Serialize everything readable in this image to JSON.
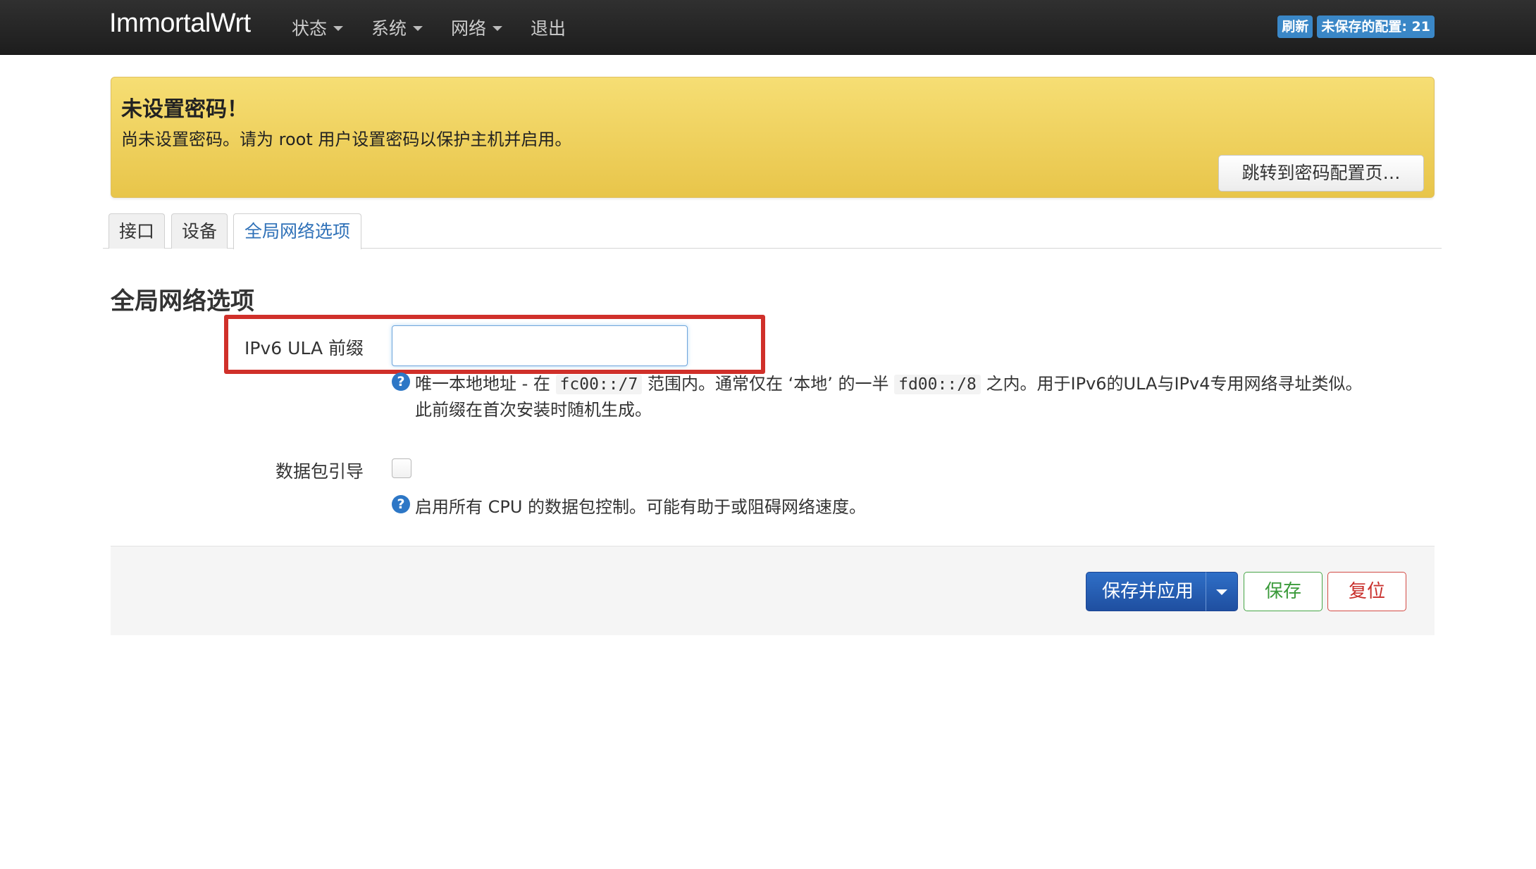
{
  "navbar": {
    "brand": "ImmortalWrt",
    "menu": [
      {
        "label": "状态",
        "has_dropdown": true
      },
      {
        "label": "系统",
        "has_dropdown": true
      },
      {
        "label": "网络",
        "has_dropdown": true
      },
      {
        "label": "退出",
        "has_dropdown": false
      }
    ],
    "badges": {
      "refresh": "刷新",
      "unsaved": "未保存的配置: 21"
    }
  },
  "alert": {
    "title": "未设置密码！",
    "text": "尚未设置密码。请为 root 用户设置密码以保护主机并启用。",
    "button": "跳转到密码配置页…"
  },
  "tabs": [
    {
      "label": "接口",
      "active": false
    },
    {
      "label": "设备",
      "active": false
    },
    {
      "label": "全局网络选项",
      "active": true
    }
  ],
  "section": {
    "title": "全局网络选项",
    "ula": {
      "label": "IPv6 ULA 前缀",
      "value": "",
      "help_part1": "唯一本地地址 - 在 ",
      "help_code1": "fc00::/7",
      "help_part2": " 范围内。通常仅在 ‘本地’ 的一半 ",
      "help_code2": "fd00::/8",
      "help_part3": " 之内。用于IPv6的ULA与IPv4专用网络寻址类似。",
      "help_line2": "此前缀在首次安装时随机生成。"
    },
    "packet_steering": {
      "label": "数据包引导",
      "checked": false,
      "help": "启用所有 CPU 的数据包控制。可能有助于或阻碍网络速度。"
    }
  },
  "actions": {
    "save_apply": "保存并应用",
    "save": "保存",
    "reset": "复位"
  },
  "colors": {
    "highlight_box": "#d0302a",
    "primary": "#2f6fc7",
    "badge": "#3a87c7",
    "alert_bg": "#f0d35e"
  }
}
